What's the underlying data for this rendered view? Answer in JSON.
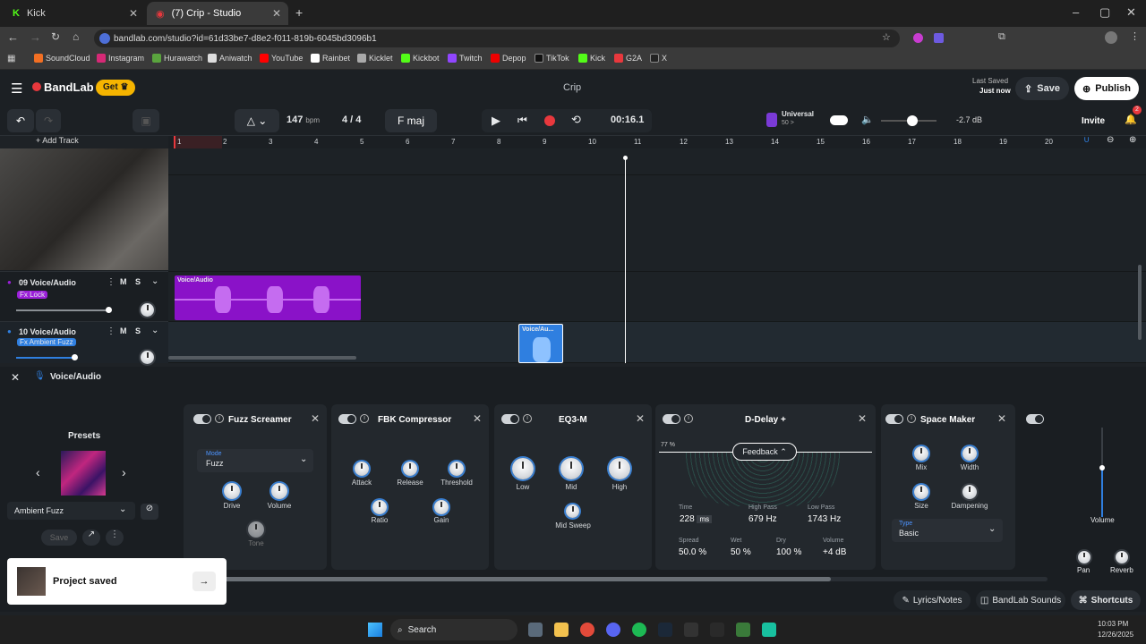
{
  "browser": {
    "tabs": [
      {
        "label": "Kick",
        "active": false
      },
      {
        "label": "(7) Crip - Studio",
        "active": true
      }
    ],
    "url": "bandlab.com/studio?id=61d33be7-d8e2-f011-819b-6045bd3096b1",
    "bookmarks": [
      "SoundCloud",
      "Instagram",
      "Hurawatch",
      "Aniwatch",
      "YouTube",
      "Rainbet",
      "Kicklet",
      "Kickbot",
      "Twitch",
      "Depop",
      "TikTok",
      "Kick",
      "G2A",
      "X"
    ]
  },
  "app": {
    "brand": "BandLab",
    "get_label": "Get",
    "project_title": "Crip",
    "last_saved_label": "Last Saved",
    "last_saved_value": "Just now",
    "save_label": "Save",
    "publish_label": "Publish",
    "invite_label": "Invite",
    "notif_count": "2"
  },
  "transport": {
    "bpm": "147",
    "bpm_unit": "bpm",
    "time_sig_num": "4",
    "time_sig_den": "4",
    "key": "F maj",
    "time": "00:16.1",
    "preset_name": "Universal",
    "preset_sub": "50 >",
    "master_db": "-2.7 dB",
    "add_track_label": "+ Add Track"
  },
  "ruler": [
    "1",
    "2",
    "3",
    "4",
    "5",
    "6",
    "7",
    "8",
    "9",
    "10",
    "11",
    "12",
    "13",
    "14",
    "15",
    "16",
    "17",
    "18",
    "19",
    "20"
  ],
  "tracks": [
    {
      "name": "09 Voice/Audio",
      "fx": "Fx Lock",
      "clip": "Voice/Audio",
      "mute": "M",
      "solo": "S",
      "color": "#9b1fd9"
    },
    {
      "name": "10 Voice/Audio",
      "fx": "Fx Ambient Fuzz",
      "clip": "Voice/Au...",
      "mute": "M",
      "solo": "S",
      "color": "#2f7fe0"
    }
  ],
  "fx_panel": {
    "track_label": "Voice/Audio",
    "presets_label": "Presets",
    "preset_selected": "Ambient Fuzz",
    "save_label": "Save",
    "effects": {
      "fuzz": {
        "title": "Fuzz Screamer",
        "mode_label": "Mode",
        "mode_value": "Fuzz",
        "drive": "Drive",
        "volume": "Volume",
        "tone": "Tone"
      },
      "comp": {
        "title": "FBK Compressor",
        "attack": "Attack",
        "release": "Release",
        "threshold": "Threshold",
        "ratio": "Ratio",
        "gain": "Gain"
      },
      "eq": {
        "title": "EQ3-M",
        "low": "Low",
        "mid": "Mid",
        "high": "High",
        "mid_sweep": "Mid Sweep"
      },
      "delay": {
        "title": "D-Delay +",
        "percent": "77 %",
        "mode": "Feedback",
        "time_label": "Time",
        "time_value": "228",
        "time_unit": "ms",
        "hp_label": "High Pass",
        "hp_value": "679 Hz",
        "lp_label": "Low Pass",
        "lp_value": "1743 Hz",
        "spread_label": "Spread",
        "spread_value": "50.0 %",
        "wet_label": "Wet",
        "wet_value": "50 %",
        "dry_label": "Dry",
        "dry_value": "100 %",
        "vol_label": "Volume",
        "vol_value": "+4 dB"
      },
      "space": {
        "title": "Space Maker",
        "mix": "Mix",
        "width": "Width",
        "size": "Size",
        "dampening": "Dampening",
        "type_label": "Type",
        "type_value": "Basic"
      }
    },
    "volume_label": "Volume",
    "pan_label": "Pan",
    "reverb_label": "Reverb"
  },
  "footer": {
    "lyrics": "Lyrics/Notes",
    "sounds": "BandLab Sounds",
    "shortcuts": "Shortcuts"
  },
  "toast": {
    "text": "Project saved"
  },
  "taskbar": {
    "search": "Search",
    "time": "10:03 PM",
    "date": "12/26/2025"
  },
  "colors": {
    "accent": "#e8383d",
    "purple": "#9b1fd9",
    "blue": "#2f7fe0",
    "get": "#f5b400"
  }
}
